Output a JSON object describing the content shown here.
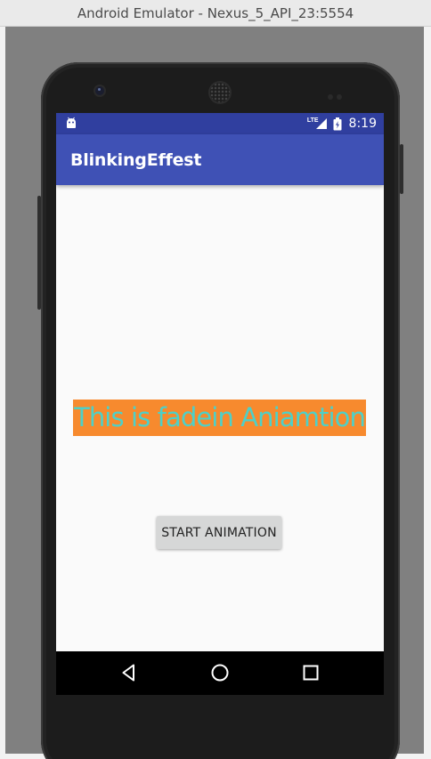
{
  "window": {
    "title": "Android Emulator - Nexus_5_API_23:5554"
  },
  "status_bar": {
    "network_label": "LTE",
    "time": "8:19",
    "icons": [
      "android-debug-icon",
      "signal-icon",
      "battery-icon"
    ]
  },
  "app_bar": {
    "title": "BlinkingEffest"
  },
  "content": {
    "fade_text": "This is fadein Aniamtion",
    "start_button_label": "START ANIMATION"
  },
  "navigation": {
    "buttons": [
      "back-icon",
      "home-icon",
      "recents-icon"
    ]
  },
  "colors": {
    "status_bar": "#303f9f",
    "app_bar": "#3f51b5",
    "fade_text_background": "#f78a2e",
    "fade_text_color": "#4dd0c8",
    "button_background": "#d6d7d7"
  }
}
